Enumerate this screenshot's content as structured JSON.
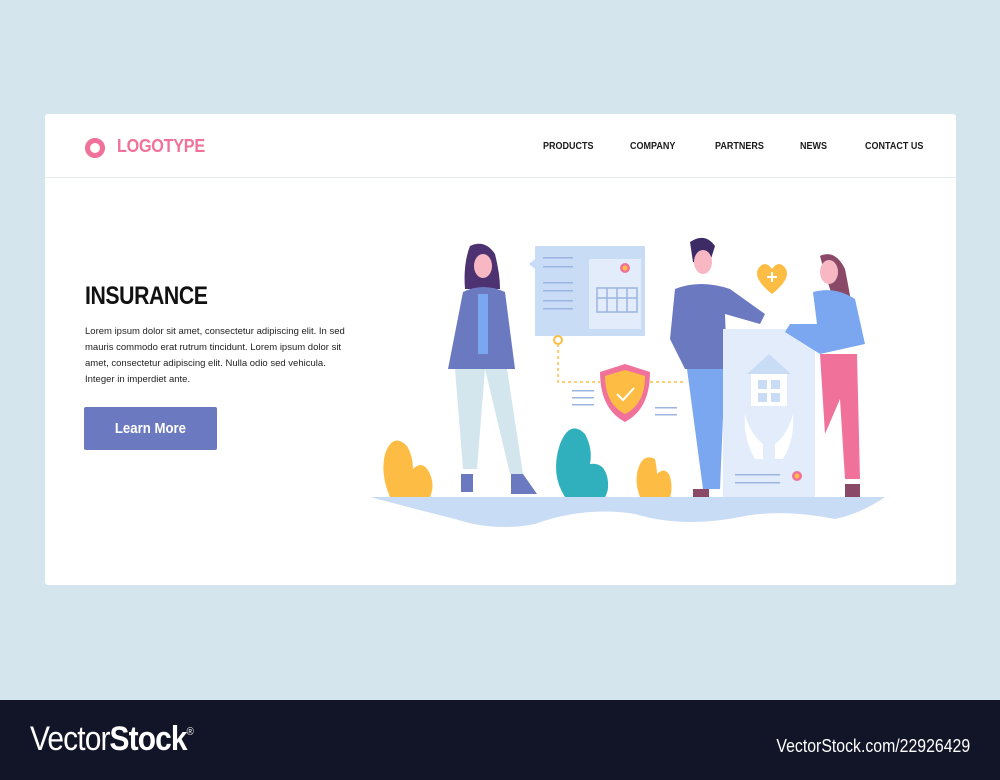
{
  "header": {
    "logo_text": "LOGOTYPE",
    "nav": [
      "PRODUCTS",
      "COMPANY",
      "PARTNERS",
      "NEWS",
      "CONTACT US"
    ]
  },
  "hero": {
    "title": "INSURANCE",
    "body": "Lorem ipsum dolor sit amet, consectetur adipiscing elit. In sed mauris commodo erat rutrum tincidunt. Lorem ipsum dolor sit amet, consectetur adipiscing elit. Nulla  odio sed vehicula. Integer in imperdiet ante.",
    "button_label": "Learn More"
  },
  "colors": {
    "accent_pink": "#f0729a",
    "button_blue": "#6b79c0",
    "page_bg": "#d5e5ee",
    "footer_bg": "#121427"
  },
  "illustration": {
    "description": "Insurance agent woman presenting policy document; couple holding home insurance certificate; shield with checkmark; heart with plus",
    "icons": [
      "document-icon",
      "certificate-seal-icon",
      "shield-check-icon",
      "heart-plus-icon",
      "house-icon",
      "hands-icon",
      "plant-icon"
    ]
  },
  "footer": {
    "brand_light": "Vector",
    "brand_bold": "Stock",
    "registered": "®",
    "url": "VectorStock.com/22926429"
  }
}
